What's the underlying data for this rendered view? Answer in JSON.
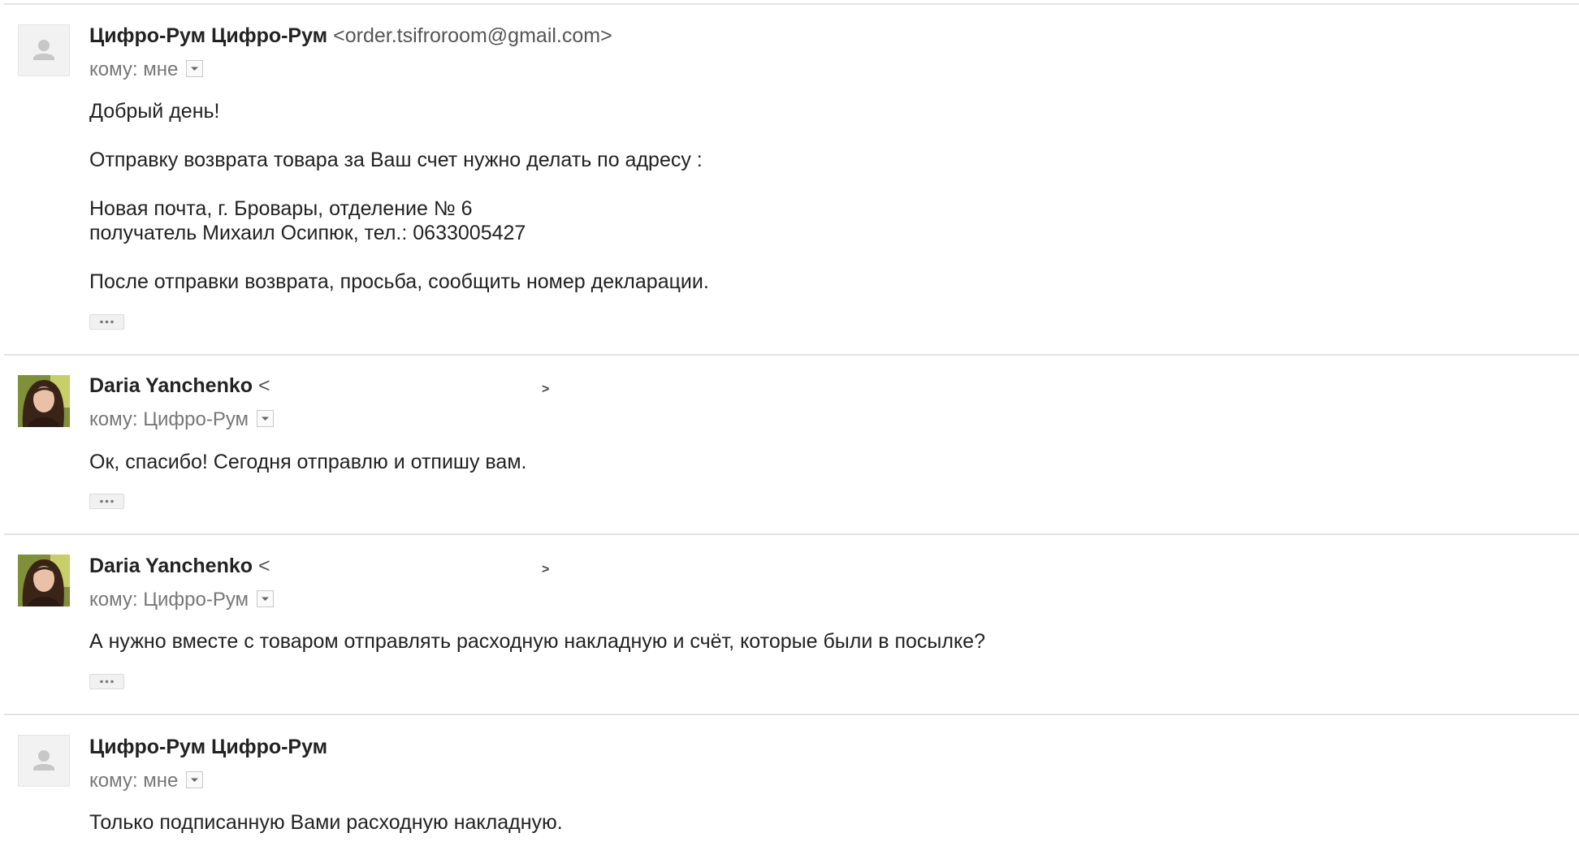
{
  "messages": [
    {
      "sender_name": "Цифро-Рум Цифро-Рум",
      "sender_email": "<order.tsifroroom@gmail.com>",
      "recipient": "кому: мне",
      "avatar_icon": "default-person-icon",
      "lines": [
        "Добрый день!",
        "Отправку возврата товара за Ваш счет нужно делать по адресу :",
        "Новая почта, г. Бровары, отделение № 6",
        "получатель Михаил Осипюк,  тел.: 0633005427",
        "После отправки возврата, просьба, сообщить номер декларации."
      ]
    },
    {
      "sender_name": "Daria Yanchenko",
      "sender_email_open": "<",
      "sender_email_close": ">",
      "recipient": "кому: Цифро-Рум",
      "avatar_icon": "user-photo",
      "lines": [
        "Ок, спасибо! Сегодня отправлю и отпишу вам."
      ]
    },
    {
      "sender_name": "Daria Yanchenko",
      "sender_email_open": "<",
      "sender_email_close": ">",
      "recipient": "кому: Цифро-Рум",
      "avatar_icon": "user-photo",
      "lines": [
        "А нужно вместе с товаром отправлять расходную накладную и счёт, которые были в посылке?"
      ]
    },
    {
      "sender_name": "Цифро-Рум Цифро-Рум",
      "recipient": "кому: мне",
      "avatar_icon": "default-person-icon",
      "lines": [
        "Только подписанную Вами расходную накладную."
      ]
    }
  ],
  "icons": {
    "details_dropdown": "chevron-down-icon",
    "show_trimmed": "ellipsis-icon"
  },
  "colors": {
    "sender_name": "#222222",
    "secondary_text": "#777777",
    "divider": "#e3e3e3"
  }
}
